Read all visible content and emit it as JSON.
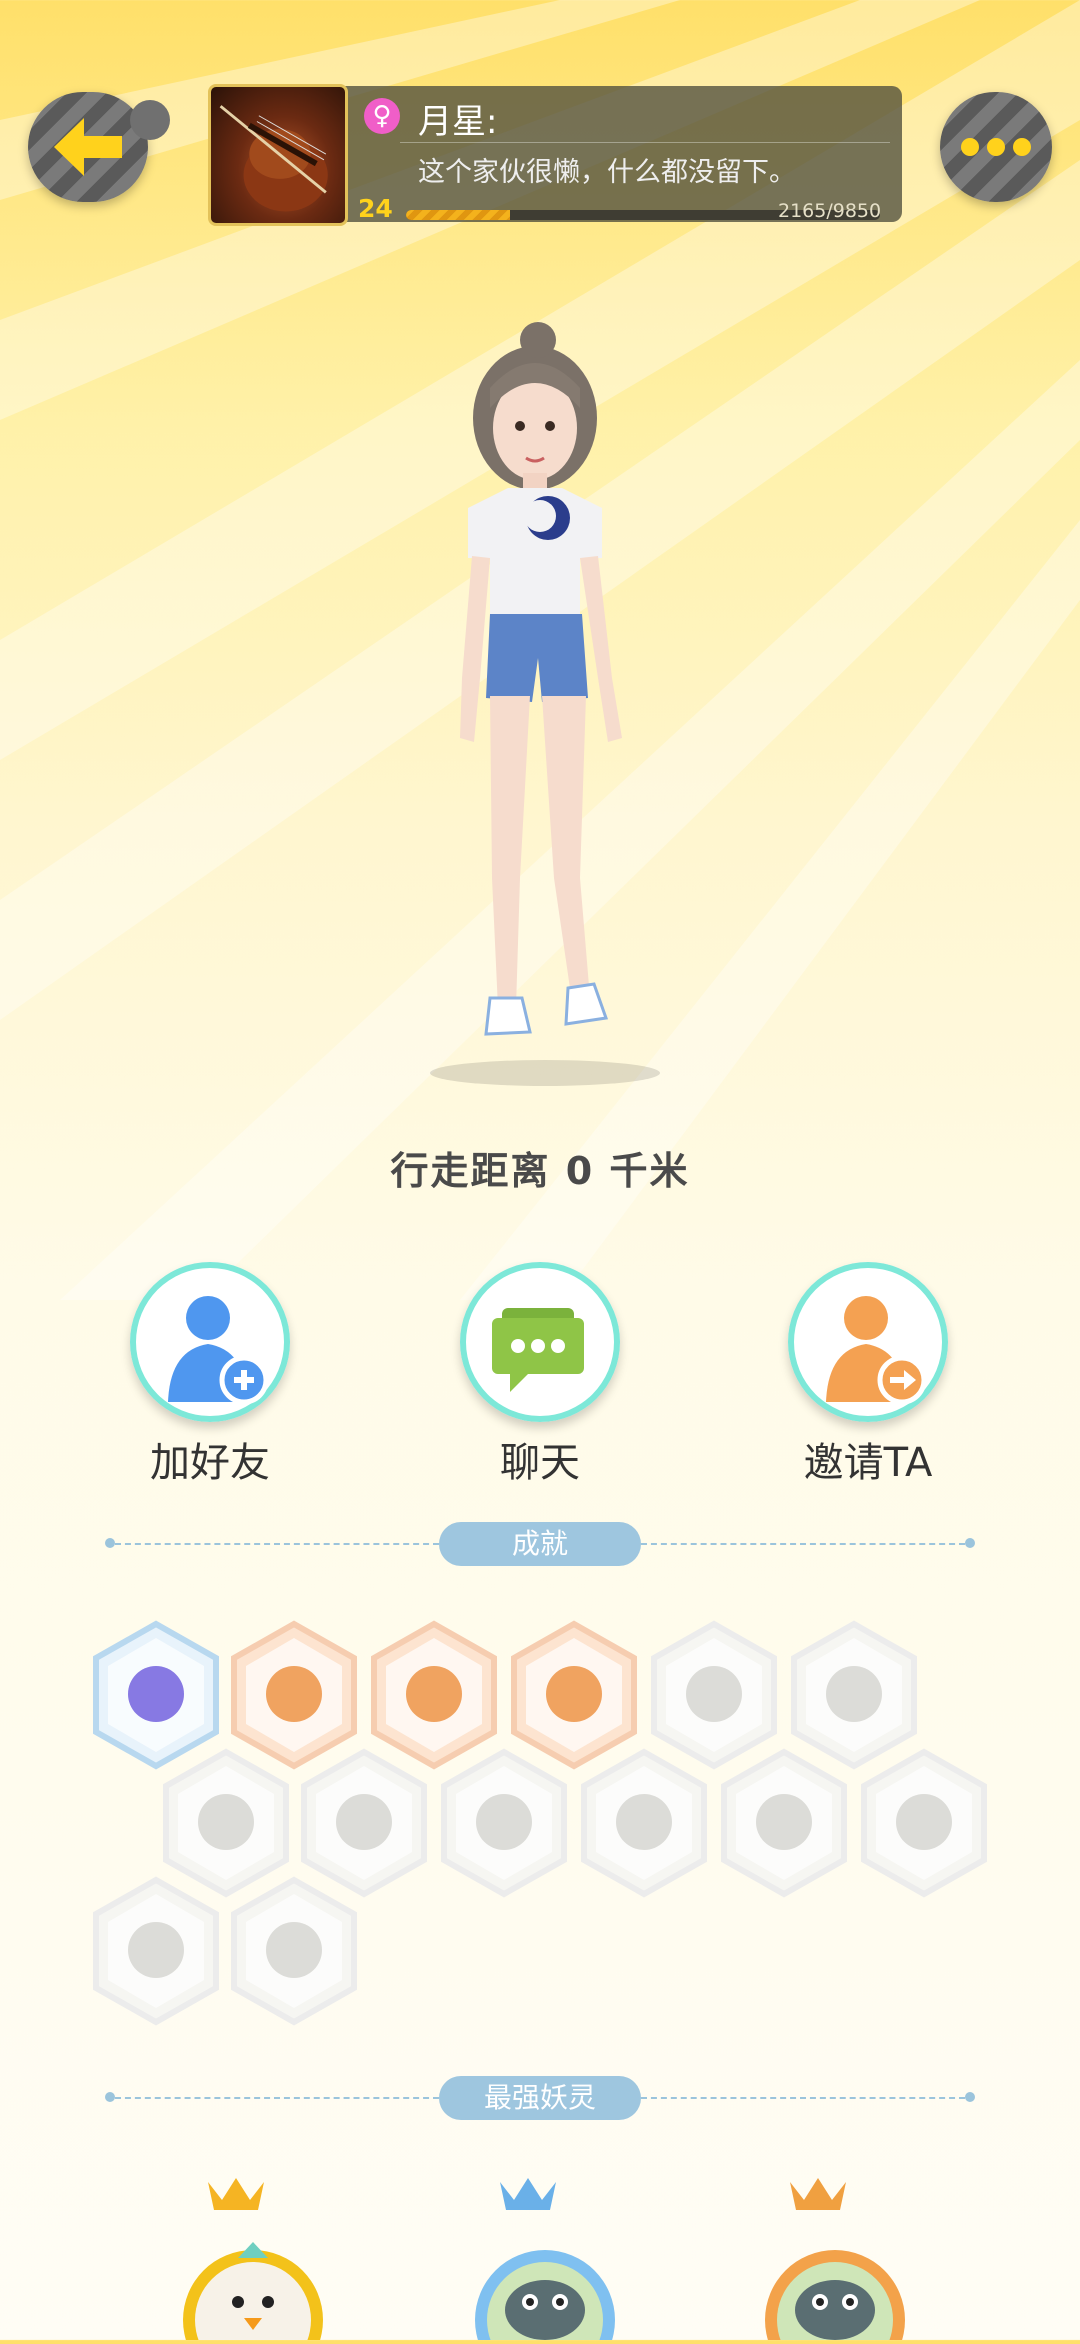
{
  "header": {
    "back_icon": "back-arrow-icon",
    "more_icon": "more-dots-icon",
    "avatar_icon": "violin-avatar",
    "gender_symbol": "♀",
    "nickname": "月星:",
    "signature": "这个家伙很懒，什么都没留下。",
    "level": "24",
    "xp_text": "2165/9850",
    "xp_progress": 0.22
  },
  "walk_distance": "行走距离 0 千米",
  "actions": [
    {
      "label": "加好友",
      "icon": "add-friend-icon"
    },
    {
      "label": "聊天",
      "icon": "chat-icon"
    },
    {
      "label": "邀请TA",
      "icon": "invite-icon"
    }
  ],
  "sections": {
    "achievements_title": "成就",
    "spirits_title": "最强妖灵"
  },
  "achievements": [
    {
      "icon": "portal-badge-icon",
      "unlocked": true
    },
    {
      "icon": "fox-badge-icon",
      "unlocked": true
    },
    {
      "icon": "taiji-swirl-badge-icon",
      "unlocked": true
    },
    {
      "icon": "taiji-book-badge-icon",
      "unlocked": true
    },
    {
      "icon": "sneaker-badge-icon",
      "unlocked": false
    },
    {
      "icon": "moon-badge-icon",
      "unlocked": false
    },
    {
      "icon": "pokeball-badge-icon",
      "unlocked": false
    },
    {
      "icon": "egg-badge-icon",
      "unlocked": false
    },
    {
      "icon": "monster-badge-icon",
      "unlocked": false
    },
    {
      "icon": "cart-badge-icon",
      "unlocked": false
    },
    {
      "icon": "cat-badge-icon",
      "unlocked": false
    },
    {
      "icon": "dragon-badge-icon",
      "unlocked": false
    },
    {
      "icon": "shield-badge-icon",
      "unlocked": false
    },
    {
      "icon": "book-fox-badge-icon",
      "unlocked": false
    }
  ],
  "spirits": [
    {
      "icon": "bird-spirit-icon",
      "crown_color": "#f5b423"
    },
    {
      "icon": "turtle-spirit-icon",
      "crown_color": "#6ab0e8"
    },
    {
      "icon": "turtle-spirit-icon",
      "crown_color": "#f0a040"
    }
  ],
  "colors": {
    "accent_yellow": "#ffd21c",
    "teal_ring": "#7de8d8",
    "section_pill": "#9ec6df"
  }
}
